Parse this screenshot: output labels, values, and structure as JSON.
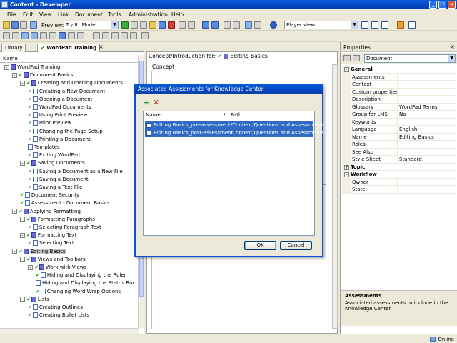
{
  "window": {
    "title": "Content - Developer"
  },
  "menu": [
    "File",
    "Edit",
    "View",
    "Link",
    "Document",
    "Tools",
    "Administration",
    "Help"
  ],
  "toolbar": {
    "preview_label": "Preview:",
    "preview_mode": "Try It! Mode",
    "player_view": "Player view"
  },
  "left_pane": {
    "tabs": {
      "library": "Library",
      "wordpad": "WordPad Training"
    },
    "tree_header": "Name",
    "tree": [
      {
        "label": "WordPad Training",
        "level": 0,
        "icon": "book",
        "exp": "-",
        "check": false
      },
      {
        "label": "Document Basics",
        "level": 1,
        "icon": "book",
        "exp": "-",
        "check": true
      },
      {
        "label": "Creating and Opening Documents",
        "level": 2,
        "icon": "book",
        "exp": "-",
        "check": true
      },
      {
        "label": "Creating a New Document",
        "level": 3,
        "icon": "page",
        "check": true
      },
      {
        "label": "Opening a Document",
        "level": 3,
        "icon": "page",
        "check": true
      },
      {
        "label": "WordPad Documents",
        "level": 3,
        "icon": "page",
        "check": true
      },
      {
        "label": "Using Print Preview",
        "level": 3,
        "icon": "page",
        "check": true
      },
      {
        "label": "Print Preview",
        "level": 3,
        "icon": "page",
        "check": true
      },
      {
        "label": "Changing the Page Setup",
        "level": 3,
        "icon": "page",
        "check": true
      },
      {
        "label": "Printing a Document",
        "level": 3,
        "icon": "page",
        "check": true
      },
      {
        "label": "Templates",
        "level": 3,
        "icon": "page",
        "check": false
      },
      {
        "label": "Exiting WordPad",
        "level": 3,
        "icon": "page",
        "check": true
      },
      {
        "label": "Saving Documents",
        "level": 2,
        "icon": "book",
        "exp": "-",
        "check": true
      },
      {
        "label": "Saving a Document as a New File",
        "level": 3,
        "icon": "page",
        "check": true
      },
      {
        "label": "Saving a Document",
        "level": 3,
        "icon": "page",
        "check": true
      },
      {
        "label": "Saving a Text File",
        "level": 3,
        "icon": "page",
        "check": true
      },
      {
        "label": "Document Security",
        "level": 2,
        "icon": "page",
        "check": true
      },
      {
        "label": "Assessment - Document Basics",
        "level": 2,
        "icon": "page",
        "check": true
      },
      {
        "label": "Applying Formatting",
        "level": 1,
        "icon": "book",
        "exp": "-",
        "check": true
      },
      {
        "label": "Formatting Paragraphs",
        "level": 2,
        "icon": "book",
        "exp": "-",
        "check": true
      },
      {
        "label": "Selecting Paragraph Text",
        "level": 3,
        "icon": "page",
        "check": true
      },
      {
        "label": "Formatting Text",
        "level": 2,
        "icon": "book",
        "exp": "-",
        "check": true
      },
      {
        "label": "Selecting Text",
        "level": 3,
        "icon": "page",
        "check": true
      },
      {
        "label": "Editing Basics",
        "level": 1,
        "icon": "book",
        "exp": "-",
        "check": true,
        "selected": true
      },
      {
        "label": "Views and Toolbars",
        "level": 2,
        "icon": "book",
        "exp": "-",
        "check": true
      },
      {
        "label": "Work with Views",
        "level": 3,
        "icon": "book",
        "exp": "-",
        "check": true
      },
      {
        "label": "Hiding and Displaying the Ruler",
        "level": 4,
        "icon": "page",
        "check": true
      },
      {
        "label": "Hiding and Displaying the Status Bar",
        "level": 4,
        "icon": "page",
        "check": false
      },
      {
        "label": "Changing Word Wrap Options",
        "level": 4,
        "icon": "page",
        "check": true
      },
      {
        "label": "Lists",
        "level": 2,
        "icon": "book",
        "exp": "-",
        "check": true
      },
      {
        "label": "Creating Outlines",
        "level": 3,
        "icon": "page",
        "check": true
      },
      {
        "label": "Creating Bullet Lists",
        "level": 3,
        "icon": "page",
        "check": true
      }
    ]
  },
  "center": {
    "heading_prefix": "Concept/Introduction for:",
    "heading_doc": "Editing Basics",
    "concept_label": "Concept"
  },
  "properties": {
    "title": "Properties",
    "selector": "Document",
    "rows": [
      {
        "type": "cat",
        "key": "General",
        "tog": "-"
      },
      {
        "key": "Assessments",
        "value": ""
      },
      {
        "key": "Context",
        "value": ""
      },
      {
        "key": "Custom properties",
        "value": ""
      },
      {
        "key": "Description",
        "value": ""
      },
      {
        "key": "Glossary",
        "value": "WordPad Terms"
      },
      {
        "key": "Group for LMS",
        "value": "No"
      },
      {
        "key": "Keywords",
        "value": ""
      },
      {
        "key": "Language",
        "value": "English"
      },
      {
        "key": "Name",
        "value": "Editing Basics"
      },
      {
        "key": "Roles",
        "value": ""
      },
      {
        "key": "See Also",
        "value": ""
      },
      {
        "key": "Style Sheet",
        "value": "Standard"
      },
      {
        "type": "cat",
        "key": "Topic",
        "tog": "+"
      },
      {
        "type": "cat",
        "key": "Workflow",
        "tog": "-"
      },
      {
        "key": "Owner",
        "value": ""
      },
      {
        "key": "State",
        "value": ""
      }
    ],
    "desc_title": "Assessments",
    "desc_text": "Associated assessments to include in the Knowledge Center."
  },
  "dialog": {
    "title": "Associated Assessments for Knowledge Center",
    "col_name": "Name",
    "col_sep": "/",
    "col_path": "Path",
    "rows": [
      {
        "name": "Editing Basics_pre-assessment",
        "path": "/Content/Questions and Assessments"
      },
      {
        "name": "Editing Basics_post-assessment",
        "path": "/Content/Questions and Assessments"
      }
    ],
    "ok": "OK",
    "cancel": "Cancel"
  },
  "status": {
    "online": "Online"
  }
}
